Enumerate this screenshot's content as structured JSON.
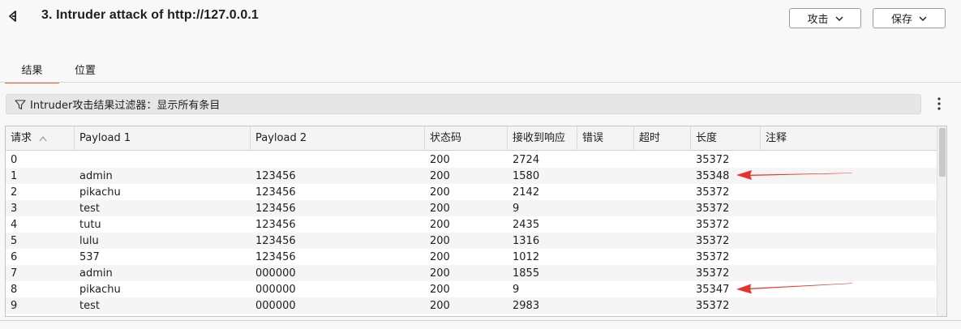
{
  "window": {
    "title": "3. Intruder attack of http://127.0.0.1"
  },
  "header": {
    "attack_button": "攻击",
    "save_button": "保存"
  },
  "tabs": [
    {
      "label": "结果",
      "active": true
    },
    {
      "label": "位置",
      "active": false
    }
  ],
  "filter": {
    "text": "Intruder攻击结果过滤器：显示所有条目"
  },
  "table": {
    "columns": [
      "请求",
      "Payload 1",
      "Payload 2",
      "状态码",
      "接收到响应",
      "错误",
      "超时",
      "长度",
      "注释"
    ],
    "sorted_column": "请求",
    "rows": [
      [
        "0",
        "",
        "",
        "200",
        "2724",
        "",
        "",
        "35372",
        ""
      ],
      [
        "1",
        "admin",
        "123456",
        "200",
        "1580",
        "",
        "",
        "35348",
        ""
      ],
      [
        "2",
        "pikachu",
        "123456",
        "200",
        "2142",
        "",
        "",
        "35372",
        ""
      ],
      [
        "3",
        "test",
        "123456",
        "200",
        "9",
        "",
        "",
        "35372",
        ""
      ],
      [
        "4",
        "tutu",
        "123456",
        "200",
        "2435",
        "",
        "",
        "35372",
        ""
      ],
      [
        "5",
        "lulu",
        "123456",
        "200",
        "1316",
        "",
        "",
        "35372",
        ""
      ],
      [
        "6",
        "537",
        "123456",
        "200",
        "1012",
        "",
        "",
        "35372",
        ""
      ],
      [
        "7",
        "admin",
        "000000",
        "200",
        "1855",
        "",
        "",
        "35372",
        ""
      ],
      [
        "8",
        "pikachu",
        "000000",
        "200",
        "9",
        "",
        "",
        "35347",
        ""
      ],
      [
        "9",
        "test",
        "000000",
        "200",
        "2983",
        "",
        "",
        "35372",
        ""
      ]
    ]
  },
  "annotations": {
    "arrow_color": "#e8312a",
    "highlighted_rows": [
      "1",
      "8"
    ]
  },
  "colors": {
    "tab_accent": "#e8632b"
  }
}
